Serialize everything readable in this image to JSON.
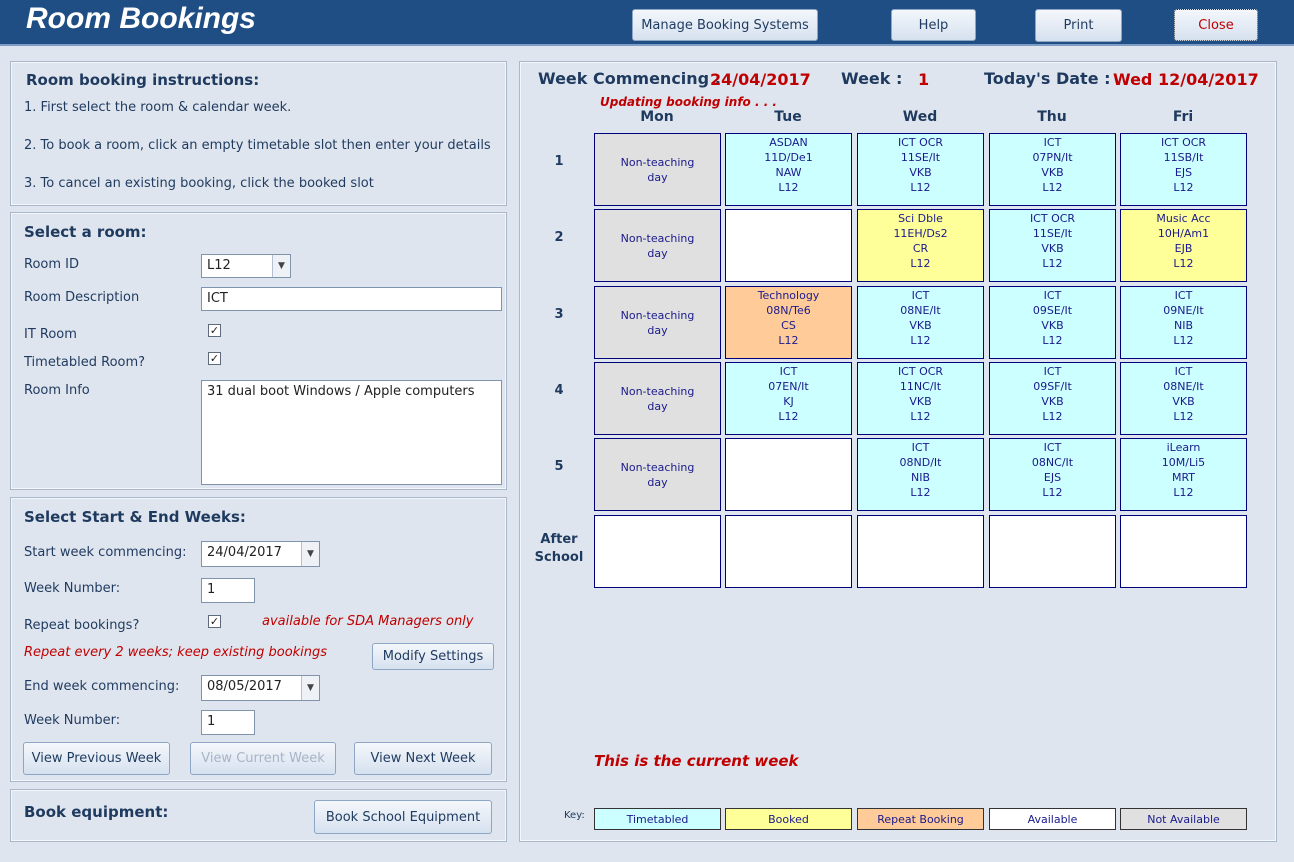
{
  "header": {
    "title": "Room Bookings",
    "buttons": {
      "manage": "Manage Booking Systems",
      "help": "Help",
      "print": "Print",
      "close": "Close"
    }
  },
  "instructions": {
    "title": "Room booking instructions:",
    "steps": [
      "1. First select the room & calendar week.",
      "2. To book a room, click an empty timetable slot then enter your details",
      "3. To cancel an existing booking, click the booked slot"
    ]
  },
  "room": {
    "title": "Select a room:",
    "id_label": "Room ID",
    "id_value": "L12",
    "desc_label": "Room Description",
    "desc_value": "ICT",
    "it_label": "IT Room",
    "it_checked": true,
    "tt_label": "Timetabled Room?",
    "tt_checked": true,
    "info_label": "Room Info",
    "info_value": "31 dual boot Windows / Apple computers"
  },
  "weeks": {
    "title": "Select Start & End Weeks:",
    "start_label": "Start week commencing:",
    "start_value": "24/04/2017",
    "wn_label": "Week Number:",
    "wn_value": "1",
    "repeat_label": "Repeat bookings?",
    "repeat_checked": true,
    "sda_note": "available for SDA Managers only",
    "repeat_note": "Repeat every 2 weeks; keep existing bookings",
    "modify": "Modify Settings",
    "end_label": "End week commencing:",
    "end_value": "08/05/2017",
    "end_wn_label": "Week Number:",
    "end_wn_value": "1",
    "prev": "View Previous Week",
    "current": "View Current Week",
    "next": "View Next Week"
  },
  "equipment": {
    "title": "Book equipment:",
    "button": "Book School Equipment"
  },
  "timetable": {
    "wc_label": "Week Commencing :",
    "wc_value": "24/04/2017",
    "week_label": "Week :",
    "week_value": "1",
    "today_label": "Today's Date :",
    "today_value": "Wed 12/04/2017",
    "updating": "Updating booking info . . .",
    "current_msg": "This is the current week",
    "days": [
      "Mon",
      "Tue",
      "Wed",
      "Thu",
      "Fri"
    ],
    "periods": [
      "1",
      "2",
      "3",
      "4",
      "5",
      "After School"
    ],
    "slots": [
      [
        {
          "s": "n",
          "l": [
            "Non-teaching",
            "day"
          ]
        },
        {
          "s": "t",
          "l": [
            "ASDAN",
            "11D/De1",
            "NAW",
            "L12"
          ]
        },
        {
          "s": "t",
          "l": [
            "ICT OCR",
            "11SE/It",
            "VKB",
            "L12"
          ]
        },
        {
          "s": "t",
          "l": [
            "ICT",
            "07PN/It",
            "VKB",
            "L12"
          ]
        },
        {
          "s": "t",
          "l": [
            "ICT OCR",
            "11SB/It",
            "EJS",
            "L12"
          ]
        }
      ],
      [
        {
          "s": "n",
          "l": [
            "Non-teaching",
            "day"
          ]
        },
        {
          "s": "a",
          "l": []
        },
        {
          "s": "b",
          "l": [
            "Sci Dble",
            "11EH/Ds2",
            "CR",
            "L12"
          ]
        },
        {
          "s": "t",
          "l": [
            "ICT OCR",
            "11SE/It",
            "VKB",
            "L12"
          ]
        },
        {
          "s": "b",
          "l": [
            "Music Acc",
            "10H/Am1",
            "EJB",
            "L12"
          ]
        }
      ],
      [
        {
          "s": "n",
          "l": [
            "Non-teaching",
            "day"
          ]
        },
        {
          "s": "r",
          "l": [
            "Technology",
            "08N/Te6",
            "CS",
            "L12"
          ]
        },
        {
          "s": "t",
          "l": [
            "ICT",
            "08NE/It",
            "VKB",
            "L12"
          ]
        },
        {
          "s": "t",
          "l": [
            "ICT",
            "09SE/It",
            "VKB",
            "L12"
          ]
        },
        {
          "s": "t",
          "l": [
            "ICT",
            "09NE/It",
            "NIB",
            "L12"
          ]
        }
      ],
      [
        {
          "s": "n",
          "l": [
            "Non-teaching",
            "day"
          ]
        },
        {
          "s": "t",
          "l": [
            "ICT",
            "07EN/It",
            "KJ",
            "L12"
          ]
        },
        {
          "s": "t",
          "l": [
            "ICT OCR",
            "11NC/It",
            "VKB",
            "L12"
          ]
        },
        {
          "s": "t",
          "l": [
            "ICT",
            "09SF/It",
            "VKB",
            "L12"
          ]
        },
        {
          "s": "t",
          "l": [
            "ICT",
            "08NE/It",
            "VKB",
            "L12"
          ]
        }
      ],
      [
        {
          "s": "n",
          "l": [
            "Non-teaching",
            "day"
          ]
        },
        {
          "s": "a",
          "l": []
        },
        {
          "s": "t",
          "l": [
            "ICT",
            "08ND/It",
            "NIB",
            "L12"
          ]
        },
        {
          "s": "t",
          "l": [
            "ICT",
            "08NC/It",
            "EJS",
            "L12"
          ]
        },
        {
          "s": "t",
          "l": [
            "iLearn",
            "10M/Li5",
            "MRT",
            "L12"
          ]
        }
      ],
      [
        {
          "s": "a",
          "l": []
        },
        {
          "s": "a",
          "l": []
        },
        {
          "s": "a",
          "l": []
        },
        {
          "s": "a",
          "l": []
        },
        {
          "s": "a",
          "l": []
        }
      ]
    ]
  },
  "key": {
    "label": "Key:",
    "items": [
      {
        "s": "t",
        "label": "Timetabled"
      },
      {
        "s": "b",
        "label": "Booked"
      },
      {
        "s": "r",
        "label": "Repeat Booking"
      },
      {
        "s": "a",
        "label": "Available"
      },
      {
        "s": "n",
        "label": "Not Available"
      }
    ]
  },
  "colors": {
    "t": "#ccffff",
    "b": "#ffff99",
    "r": "#ffcc99",
    "a": "#ffffff",
    "n": "#e0e0e0",
    "header": "#1f4e84",
    "alert": "#c00000"
  }
}
